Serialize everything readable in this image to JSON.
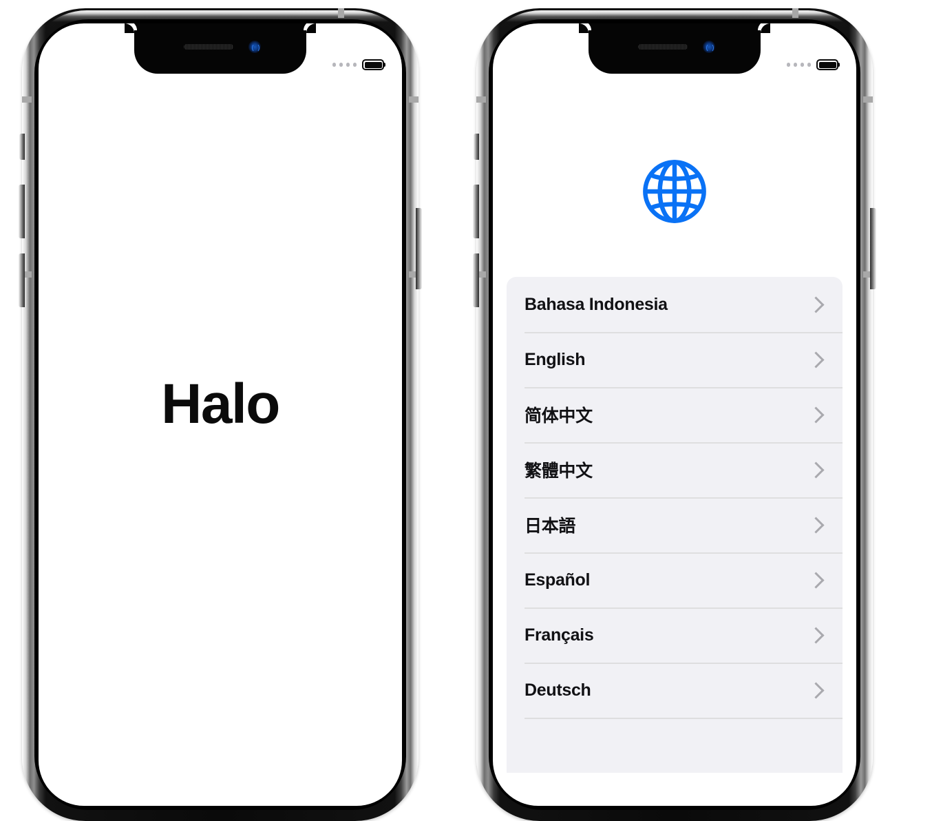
{
  "colors": {
    "globe_blue": "#0a72f5",
    "list_background": "#f1f1f5",
    "separator": "#dededf",
    "chevron": "#a9a9ae",
    "text": "#111114",
    "screen_background": "#ffffff"
  },
  "phones": [
    {
      "id": "phone-left",
      "label": "iPhone showing greeting screen",
      "status_bar": {
        "signal_dots": 4,
        "battery_level_full": true
      },
      "screen": {
        "type": "greeting",
        "greeting_text": "Halo"
      }
    },
    {
      "id": "phone-right",
      "label": "iPhone showing language selection screen",
      "status_bar": {
        "signal_dots": 4,
        "battery_level_full": true
      },
      "screen": {
        "type": "language-picker",
        "icon": "globe-icon",
        "languages": [
          {
            "label": "Bahasa Indonesia",
            "chevron": "chevron-right-icon"
          },
          {
            "label": "English",
            "chevron": "chevron-right-icon"
          },
          {
            "label": "简体中文",
            "chevron": "chevron-right-icon"
          },
          {
            "label": "繁體中文",
            "chevron": "chevron-right-icon"
          },
          {
            "label": "日本語",
            "chevron": "chevron-right-icon"
          },
          {
            "label": "Español",
            "chevron": "chevron-right-icon"
          },
          {
            "label": "Français",
            "chevron": "chevron-right-icon"
          },
          {
            "label": "Deutsch",
            "chevron": "chevron-right-icon"
          }
        ]
      }
    }
  ]
}
